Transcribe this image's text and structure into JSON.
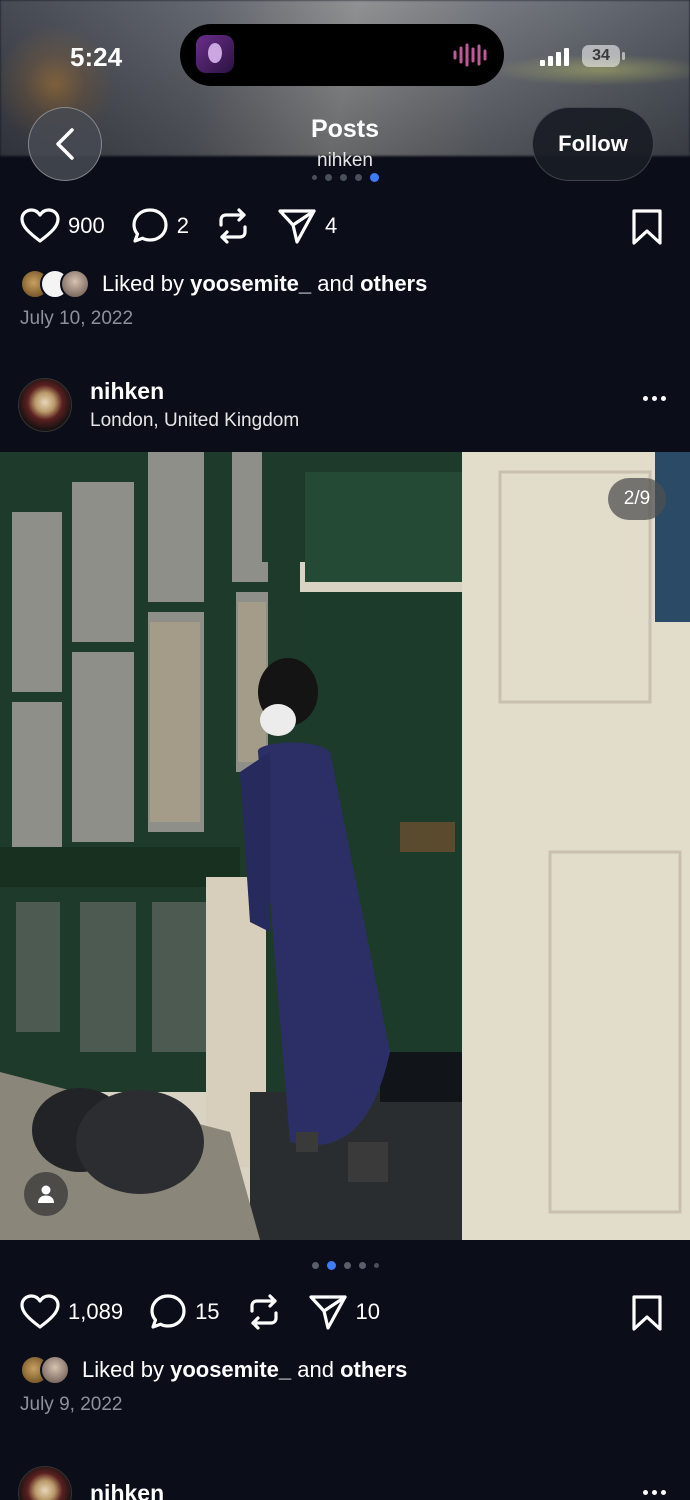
{
  "status_bar": {
    "time": "5:24",
    "battery": "34"
  },
  "header": {
    "title": "Posts",
    "subtitle": "nihken",
    "follow_label": "Follow"
  },
  "post1": {
    "likes": "900",
    "comments": "2",
    "shares": "4",
    "liked_by_prefix": "Liked by",
    "liked_by_user": "yoosemite_",
    "liked_by_and": "and",
    "liked_by_others": "others",
    "date": "July 10, 2022"
  },
  "post2": {
    "author": "nihken",
    "location": "London, United Kingdom",
    "photo_counter": "2/9",
    "likes": "1,089",
    "comments": "15",
    "shares": "10",
    "liked_by_prefix": "Liked by",
    "liked_by_user": "yoosemite_",
    "liked_by_and": "and",
    "liked_by_others": "others",
    "date": "July 9, 2022"
  },
  "post3": {
    "author": "nihken"
  },
  "icons": [
    "back-chevron-icon",
    "heart-icon",
    "comment-icon",
    "repost-icon",
    "send-icon",
    "bookmark-icon",
    "more-icon",
    "person-tag-icon"
  ],
  "colors": {
    "accent_dot": "#3d7bff",
    "background": "#0b0e19"
  }
}
